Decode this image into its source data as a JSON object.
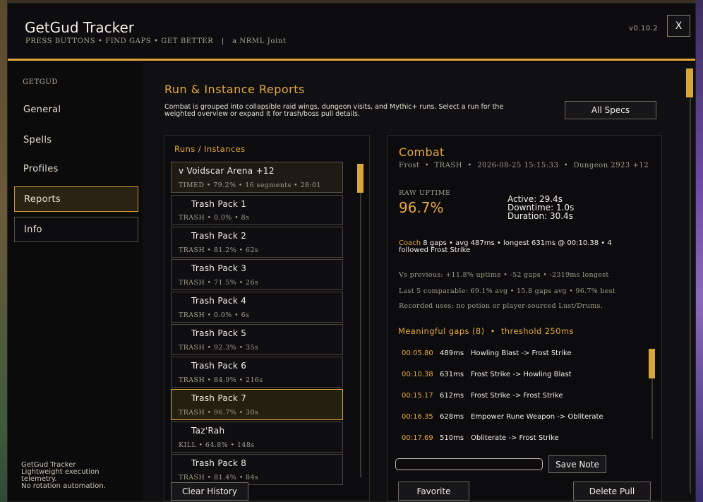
{
  "header": {
    "title": "GetGud Tracker",
    "subtitle": "PRESS BUTTONS • FIND GAPS • GET BETTER   |   a NRML Joint",
    "version": "v0.10.2",
    "close_label": "X"
  },
  "sidebar": {
    "heading": "GETGUD",
    "items": [
      {
        "label": "General"
      },
      {
        "label": "Spells"
      },
      {
        "label": "Profiles"
      },
      {
        "label": "Reports"
      },
      {
        "label": "Info"
      }
    ],
    "footer": [
      "GetGud Tracker",
      "Lightweight execution",
      "telemetry.",
      "No rotation automation."
    ]
  },
  "main": {
    "title": "Run & Instance Reports",
    "description": "Combat is grouped into collapsible raid wings, dungeon visits, and Mythic+ runs. Select a run for the weighted overview or expand it for trash/boss pull details.",
    "specs_button": "All Specs",
    "clear_history": "Clear History"
  },
  "runs": {
    "title": "Runs / Instances",
    "items": [
      {
        "name": "v Voidscar Arena +12",
        "meta": "TIMED • 79.2% • 16 segments • 28:01"
      },
      {
        "name": "Trash Pack 1",
        "meta": "TRASH • 0.0% • 8s"
      },
      {
        "name": "Trash Pack 2",
        "meta": "TRASH • 81.2% • 62s"
      },
      {
        "name": "Trash Pack 3",
        "meta": "TRASH • 71.5% • 26s"
      },
      {
        "name": "Trash Pack 4",
        "meta": "TRASH • 0.0% • 6s"
      },
      {
        "name": "Trash Pack 5",
        "meta": "TRASH • 92.3% • 35s"
      },
      {
        "name": "Trash Pack 6",
        "meta": "TRASH • 84.9% • 216s"
      },
      {
        "name": "Trash Pack 7",
        "meta": "TRASH • 96.7% • 30s"
      },
      {
        "name": "Taz'Rah",
        "meta": "KILL • 64.8% • 148s"
      },
      {
        "name": "Trash Pack 8",
        "meta": "TRASH • 81.4% • 84s"
      }
    ]
  },
  "detail": {
    "title": "Combat",
    "subtitle": "Frost  •  TRASH  •  2026-08-25 15:15:33  •  Dungeon 2923 +12",
    "raw_label": "RAW UPTIME",
    "raw_value": "96.7%",
    "active": "Active: 29.4s",
    "downtime": "Downtime: 1.0s",
    "duration": "Duration: 30.4s",
    "coach_label": "Coach",
    "coach_text": " 8 gaps • avg 487ms • longest 631ms @ 00:10.38 • 4 followed Frost Strike",
    "vs_previous": "Vs previous: +11.8% uptime • -52 gaps • -2319ms longest",
    "last_five": "Last 5 comparable: 69.1% avg • 15.8 gaps avg • 96.7% best",
    "recorded": "Recorded uses: no potion or player-sourced Lust/Drums.",
    "gaps_title": "Meaningful gaps (8)  •  threshold 250ms",
    "gaps": [
      {
        "time": "00:05.80",
        "ms": "489ms",
        "desc": "Howling Blast -> Frost Strike"
      },
      {
        "time": "00:10.38",
        "ms": "631ms",
        "desc": "Frost Strike -> Howling Blast"
      },
      {
        "time": "00:15.17",
        "ms": "612ms",
        "desc": "Frost Strike -> Frost Strike"
      },
      {
        "time": "00:16.35",
        "ms": "628ms",
        "desc": "Empower Rune Weapon -> Obliterate"
      },
      {
        "time": "00:17.69",
        "ms": "510ms",
        "desc": "Obliterate -> Frost Strike"
      }
    ],
    "save_note": "Save Note",
    "favorite": "Favorite",
    "delete_pull": "Delete Pull"
  }
}
